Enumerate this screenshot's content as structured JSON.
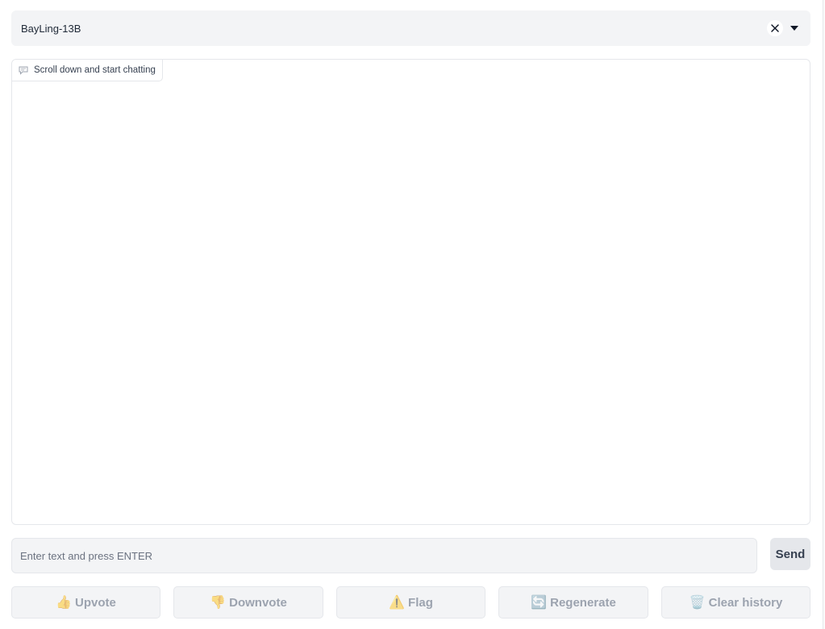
{
  "model_selector": {
    "value": "BayLing-13B",
    "clear_icon": "close-icon",
    "dropdown_icon": "caret-down-icon"
  },
  "chatbot": {
    "label": "Scroll down and start chatting",
    "label_icon": "chat-bubble-icon"
  },
  "input": {
    "placeholder": "Enter text and press ENTER",
    "value": ""
  },
  "send_button": {
    "label": "Send"
  },
  "actions": {
    "upvote": {
      "icon": "👍",
      "label": "Upvote"
    },
    "downvote": {
      "icon": "👎",
      "label": "Downvote"
    },
    "flag": {
      "icon": "⚠️",
      "label": "Flag"
    },
    "regenerate": {
      "icon": "🔄",
      "label": "Regenerate"
    },
    "clear": {
      "icon": "🗑️",
      "label": "Clear history"
    }
  },
  "colors": {
    "panel_bg": "#f3f4f6",
    "border": "#e5e7eb",
    "disabled_text": "#9ca3af"
  }
}
